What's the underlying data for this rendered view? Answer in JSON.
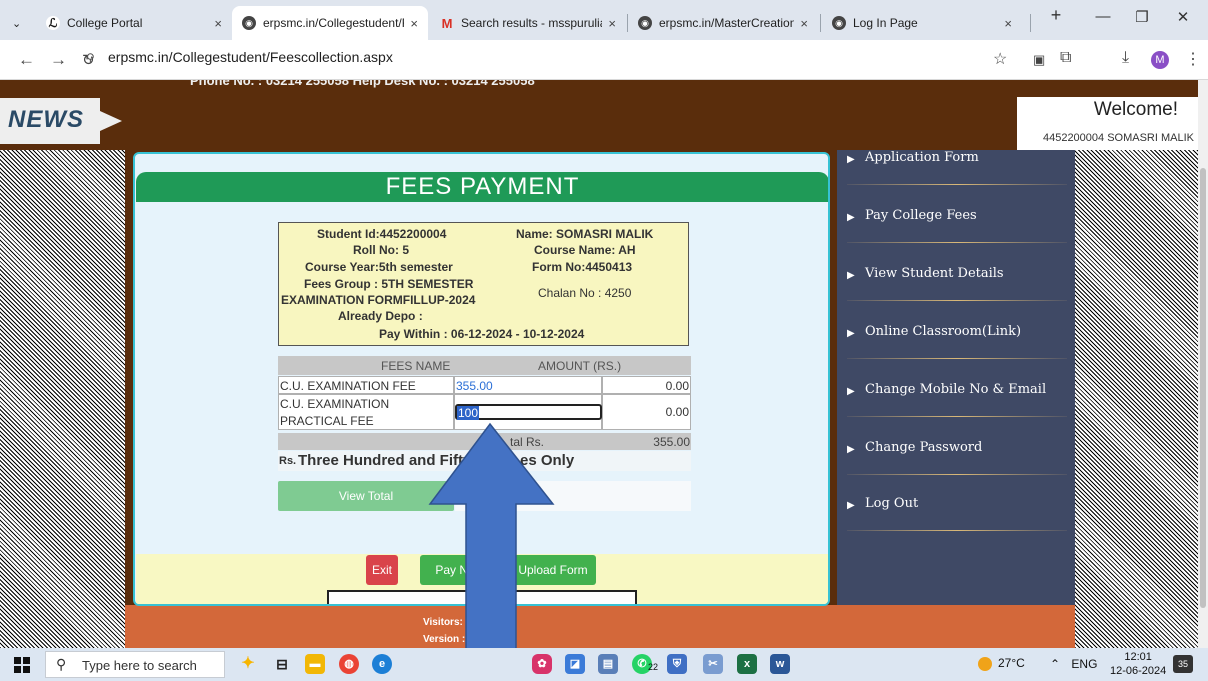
{
  "browser": {
    "tabs": [
      {
        "title": "College Portal",
        "close": "×"
      },
      {
        "title": "erpsmc.in/Collegestudent/Fe",
        "close": "×"
      },
      {
        "title": "Search results - msspurulia@",
        "close": "×"
      },
      {
        "title": "erpsmc.in/MasterCreation/D",
        "close": "×"
      },
      {
        "title": "Log In Page",
        "close": "×"
      }
    ],
    "url": "erpsmc.in/Collegestudent/Feescollection.aspx",
    "avatar_letter": "M"
  },
  "header": {
    "phone_line": "Phone No. : 03214 255058     Help Desk No. : 03214 255058",
    "news_label": "NEWS",
    "welcome": "Welcome!",
    "user": "4452200004 SOMASRI MALIK"
  },
  "sidebar": {
    "items": [
      {
        "label": "Application Form"
      },
      {
        "label": "Pay College Fees"
      },
      {
        "label": "View Student Details"
      },
      {
        "label": "Online Classroom(Link)"
      },
      {
        "label": "Change Mobile No & Email"
      },
      {
        "label": "Change Password"
      },
      {
        "label": "Log Out"
      }
    ]
  },
  "fees": {
    "title": "FEES PAYMENT",
    "student_id": "Student Id:4452200004",
    "name": "Name: SOMASRI MALIK",
    "roll": "Roll No: 5",
    "course_name": "Course Name: AH",
    "course_year": "Course Year:5th semester",
    "form_no": "Form No:4450413",
    "fees_group_1": "Fees Group : 5TH SEMESTER",
    "fees_group_2": "EXAMINATION FORMFILLUP-2024",
    "chalan": "Chalan No : 4250",
    "already_depo": "Already Depo :",
    "pay_within": "Pay Within : 06-12-2024 - 10-12-2024",
    "col_name": "FEES NAME",
    "col_amount": "AMOUNT (RS.)",
    "rows": [
      {
        "name": "C.U. EXAMINATION FEE",
        "input": "355.00",
        "amount": "0.00"
      },
      {
        "name_1": "C.U. EXAMINATION",
        "name_2": "PRACTICAL FEE",
        "input": "100",
        "amount": "0.00"
      }
    ],
    "total_label": "Total Rs.",
    "total_visible": "tal Rs.",
    "total_value": "355.00",
    "words_prefix": "Rs.",
    "words_left": "Three Hundred and Fifty",
    "words_right": "es Only",
    "view_total": "View Total",
    "exit": "Exit",
    "pay_now": "Pay No",
    "upload_form": "Upload Form"
  },
  "footer": {
    "visitors": "Visitors: 3",
    "version": "Version :"
  },
  "taskbar": {
    "search_placeholder": "Type here to search",
    "whatsapp_badge": "22",
    "temperature": "27°C",
    "language": "ENG",
    "time": "12:01",
    "date": "12-06-2024",
    "notifications": "35"
  },
  "colors": {
    "header_brown": "#5a2d0c",
    "fees_green": "#1f9a57",
    "sidebar_navy": "#3f4965",
    "footer_orange": "#d3683a",
    "arrow_blue": "#4472c4"
  }
}
